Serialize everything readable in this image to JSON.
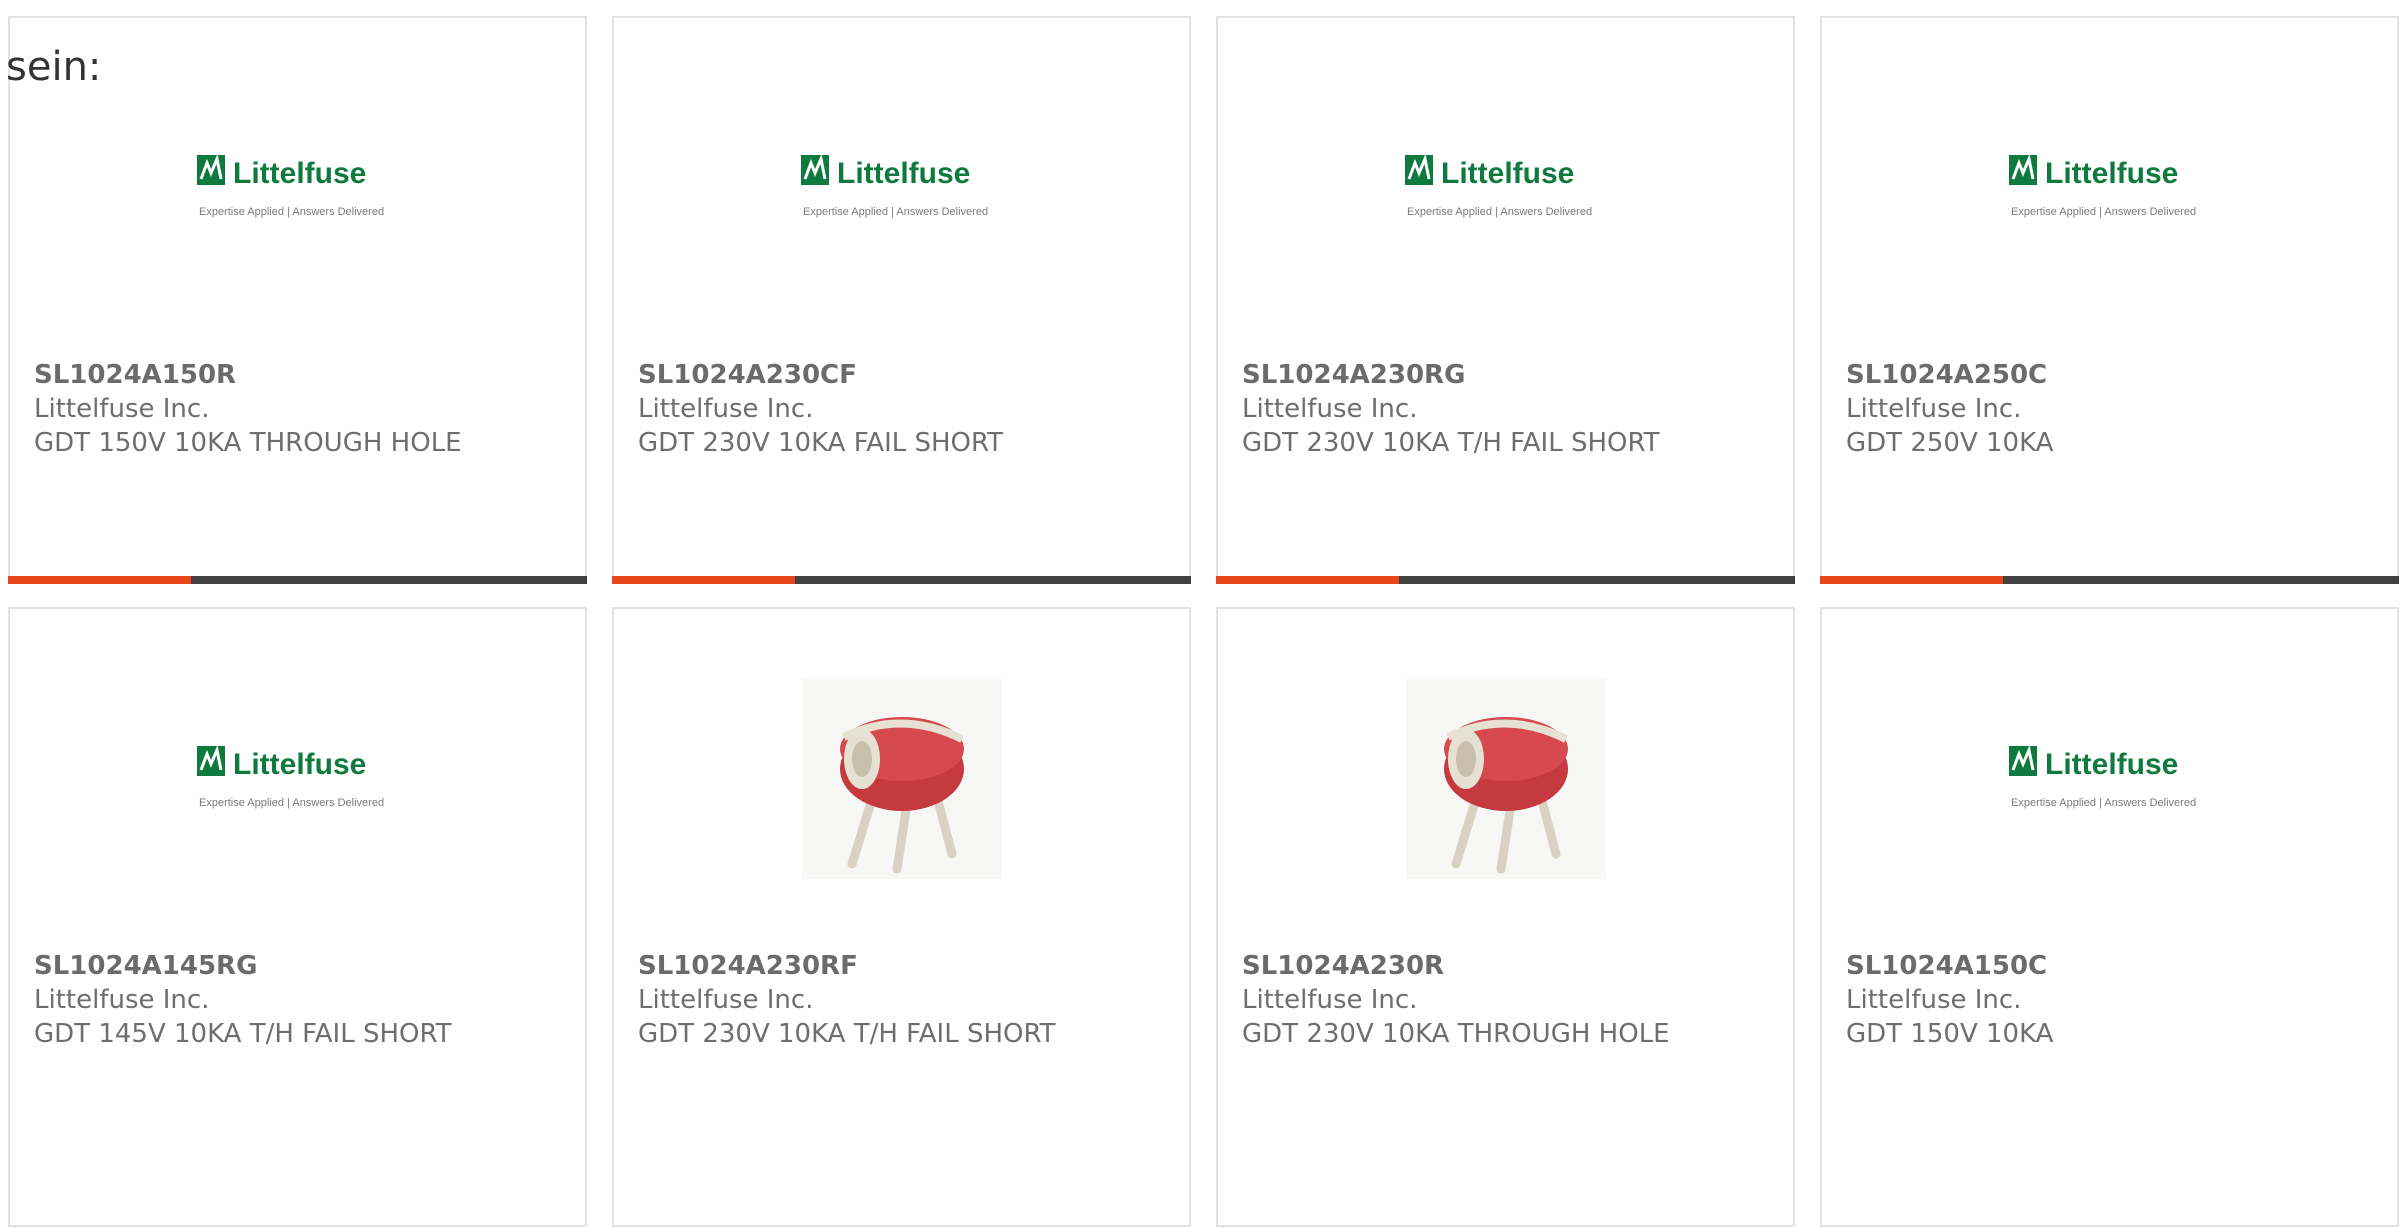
{
  "intro_text": "sein:",
  "colors": {
    "brand_green": "#0f7a3d",
    "accent": "#e8451a",
    "bar": "#414141"
  },
  "logo": {
    "name": "Littelfuse",
    "tagline": "Expertise Applied | Answers Delivered"
  },
  "products": [
    {
      "part_number": "SL1024A150R",
      "manufacturer": "Littelfuse Inc.",
      "description": "GDT 150V 10KA THROUGH HOLE",
      "image": "littelfuse-logo"
    },
    {
      "part_number": "SL1024A230CF",
      "manufacturer": "Littelfuse Inc.",
      "description": "GDT 230V 10KA FAIL SHORT",
      "image": "littelfuse-logo"
    },
    {
      "part_number": "SL1024A230RG",
      "manufacturer": "Littelfuse Inc.",
      "description": "GDT 230V 10KA T/H FAIL SHORT",
      "image": "littelfuse-logo"
    },
    {
      "part_number": "SL1024A250C",
      "manufacturer": "Littelfuse Inc.",
      "description": "GDT 250V 10KA",
      "image": "littelfuse-logo"
    },
    {
      "part_number": "SL1024A145RG",
      "manufacturer": "Littelfuse Inc.",
      "description": "GDT 145V 10KA T/H FAIL SHORT",
      "image": "littelfuse-logo"
    },
    {
      "part_number": "SL1024A230RF",
      "manufacturer": "Littelfuse Inc.",
      "description": "GDT 230V 10KA T/H FAIL SHORT",
      "image": "gdt-component-photo"
    },
    {
      "part_number": "SL1024A230R",
      "manufacturer": "Littelfuse Inc.",
      "description": "GDT 230V 10KA THROUGH HOLE",
      "image": "gdt-component-photo"
    },
    {
      "part_number": "SL1024A150C",
      "manufacturer": "Littelfuse Inc.",
      "description": "GDT 150V 10KA",
      "image": "littelfuse-logo"
    }
  ]
}
